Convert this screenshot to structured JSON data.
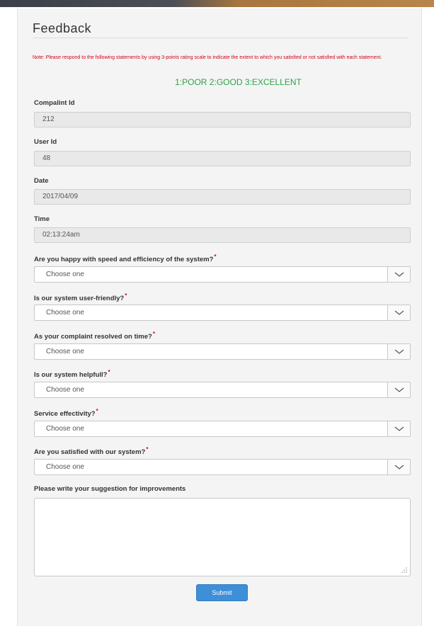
{
  "form": {
    "title": "Feedback",
    "note": "Note: Please respond to the following statements by using 3-points rating scale to indicate the extent to which you satisfied or not satisfied with each statement.",
    "scale": "1:POOR 2:GOOD 3:EXCELLENT",
    "complaint_id_label": "Compalint Id",
    "complaint_id_value": "212",
    "user_id_label": "User Id",
    "user_id_value": "48",
    "date_label": "Date",
    "date_value": "2017/04/09",
    "time_label": "Time",
    "time_value": "02:13:24am",
    "questions": [
      {
        "label": "Are you happy with speed and efficiency of the system?",
        "value": "Choose one"
      },
      {
        "label": "Is our system user-friendly?",
        "value": "Choose one"
      },
      {
        "label": "As your complaint resolved on time?",
        "value": "Choose one"
      },
      {
        "label": "Is our system helpfull?",
        "value": "Choose one"
      },
      {
        "label": "Service effectivity?",
        "value": "Choose one"
      },
      {
        "label": "Are you satisfied with our system?",
        "value": "Choose one"
      }
    ],
    "required_mark": "*",
    "suggestion_label": "Please write your suggestion for improvements",
    "submit_label": "Submit"
  },
  "colors": {
    "note": "#d0021b",
    "scale": "#2ea24a",
    "submit": "#3f8fd8"
  }
}
